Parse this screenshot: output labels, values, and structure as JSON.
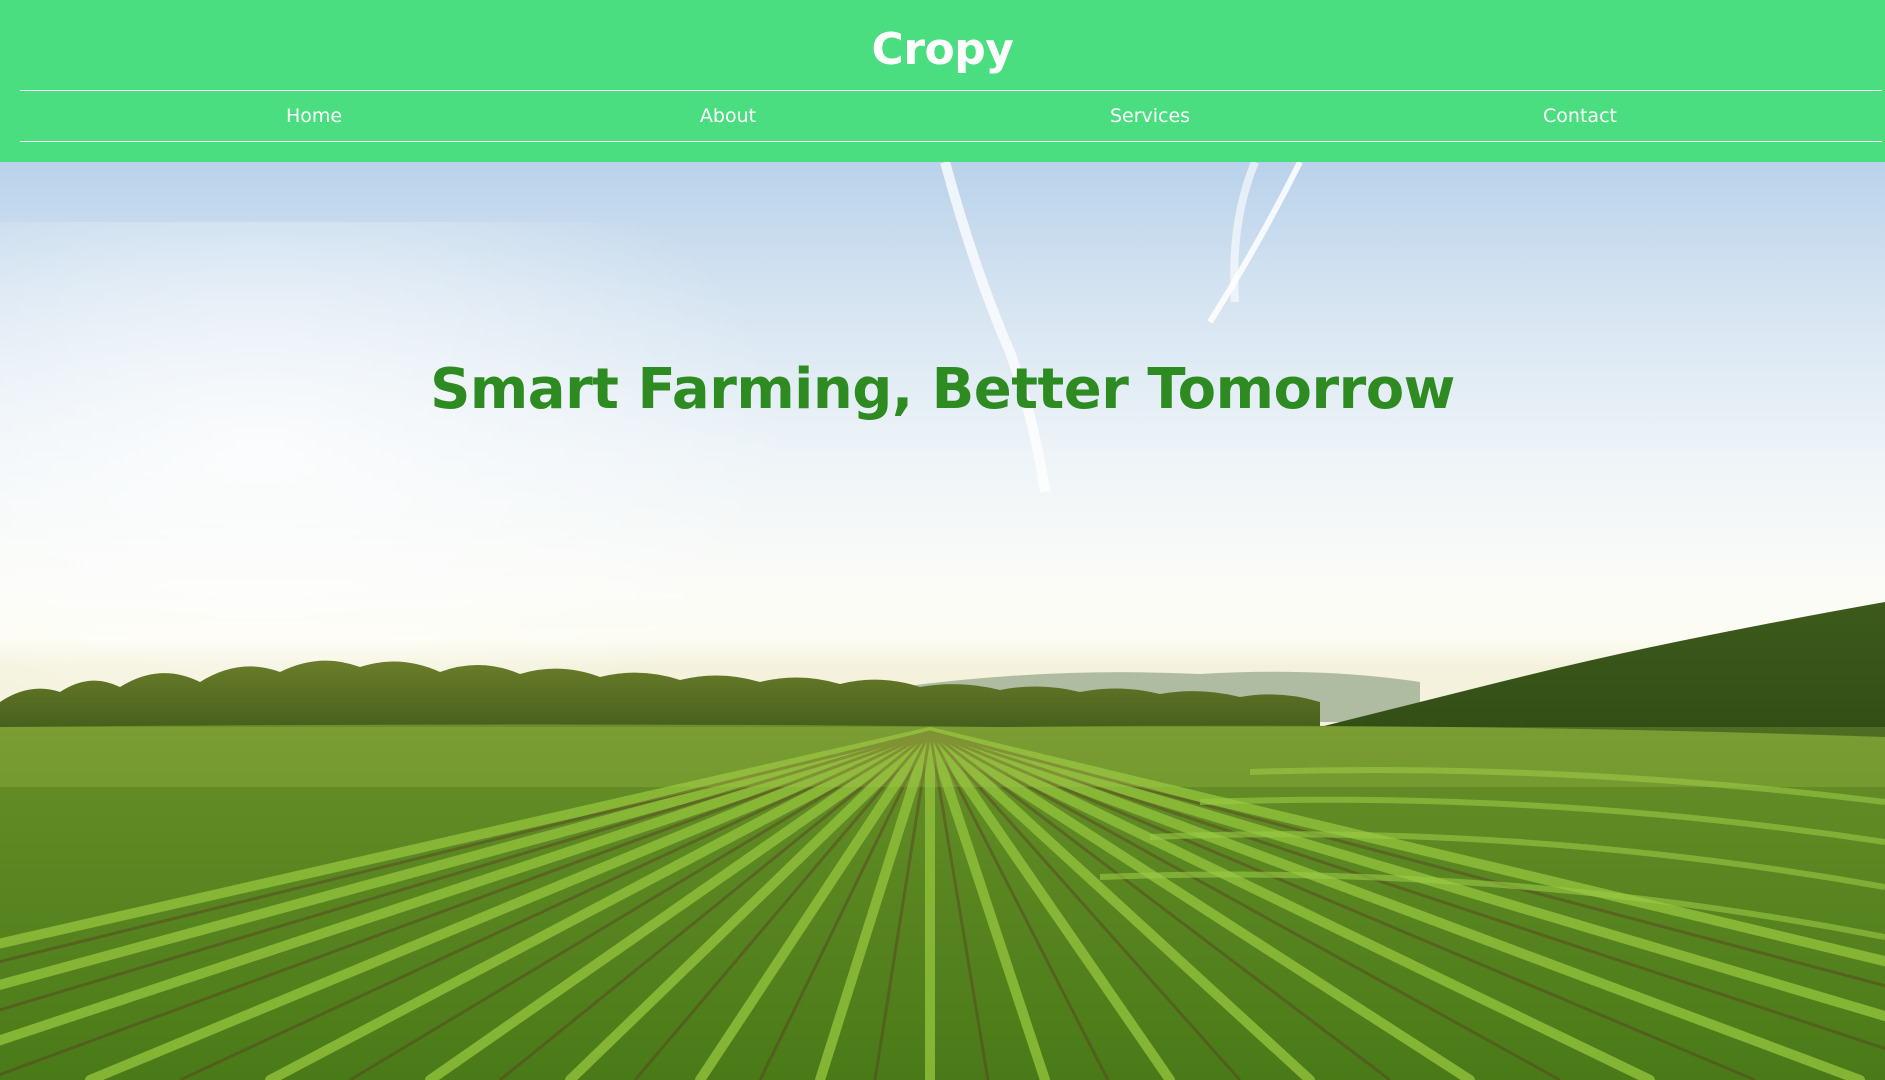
{
  "brand": {
    "name": "Cropy"
  },
  "nav": {
    "items": [
      {
        "label": "Home"
      },
      {
        "label": "About"
      },
      {
        "label": "Services"
      },
      {
        "label": "Contact"
      }
    ]
  },
  "hero": {
    "headline": "Smart Farming, Better Tomorrow",
    "image": "farm-field-sunrise"
  },
  "colors": {
    "header_bg": "#4ade80",
    "header_text": "#ffffff",
    "headline_text": "#2e8b22"
  }
}
